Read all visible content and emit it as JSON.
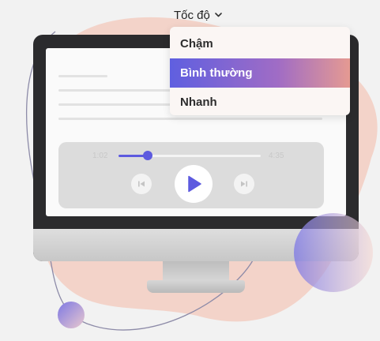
{
  "speed": {
    "label": "Tốc độ",
    "options": [
      "Chậm",
      "Bình thường",
      "Nhanh"
    ],
    "selected": "Bình thường"
  },
  "player": {
    "elapsed": "1:02",
    "duration": "4:35",
    "progress": 0.2
  },
  "colors": {
    "accent": "#5d5adf",
    "blob": "#f3d3c9",
    "selected_gradient": [
      "#5f5fe0",
      "#e59a92"
    ]
  }
}
